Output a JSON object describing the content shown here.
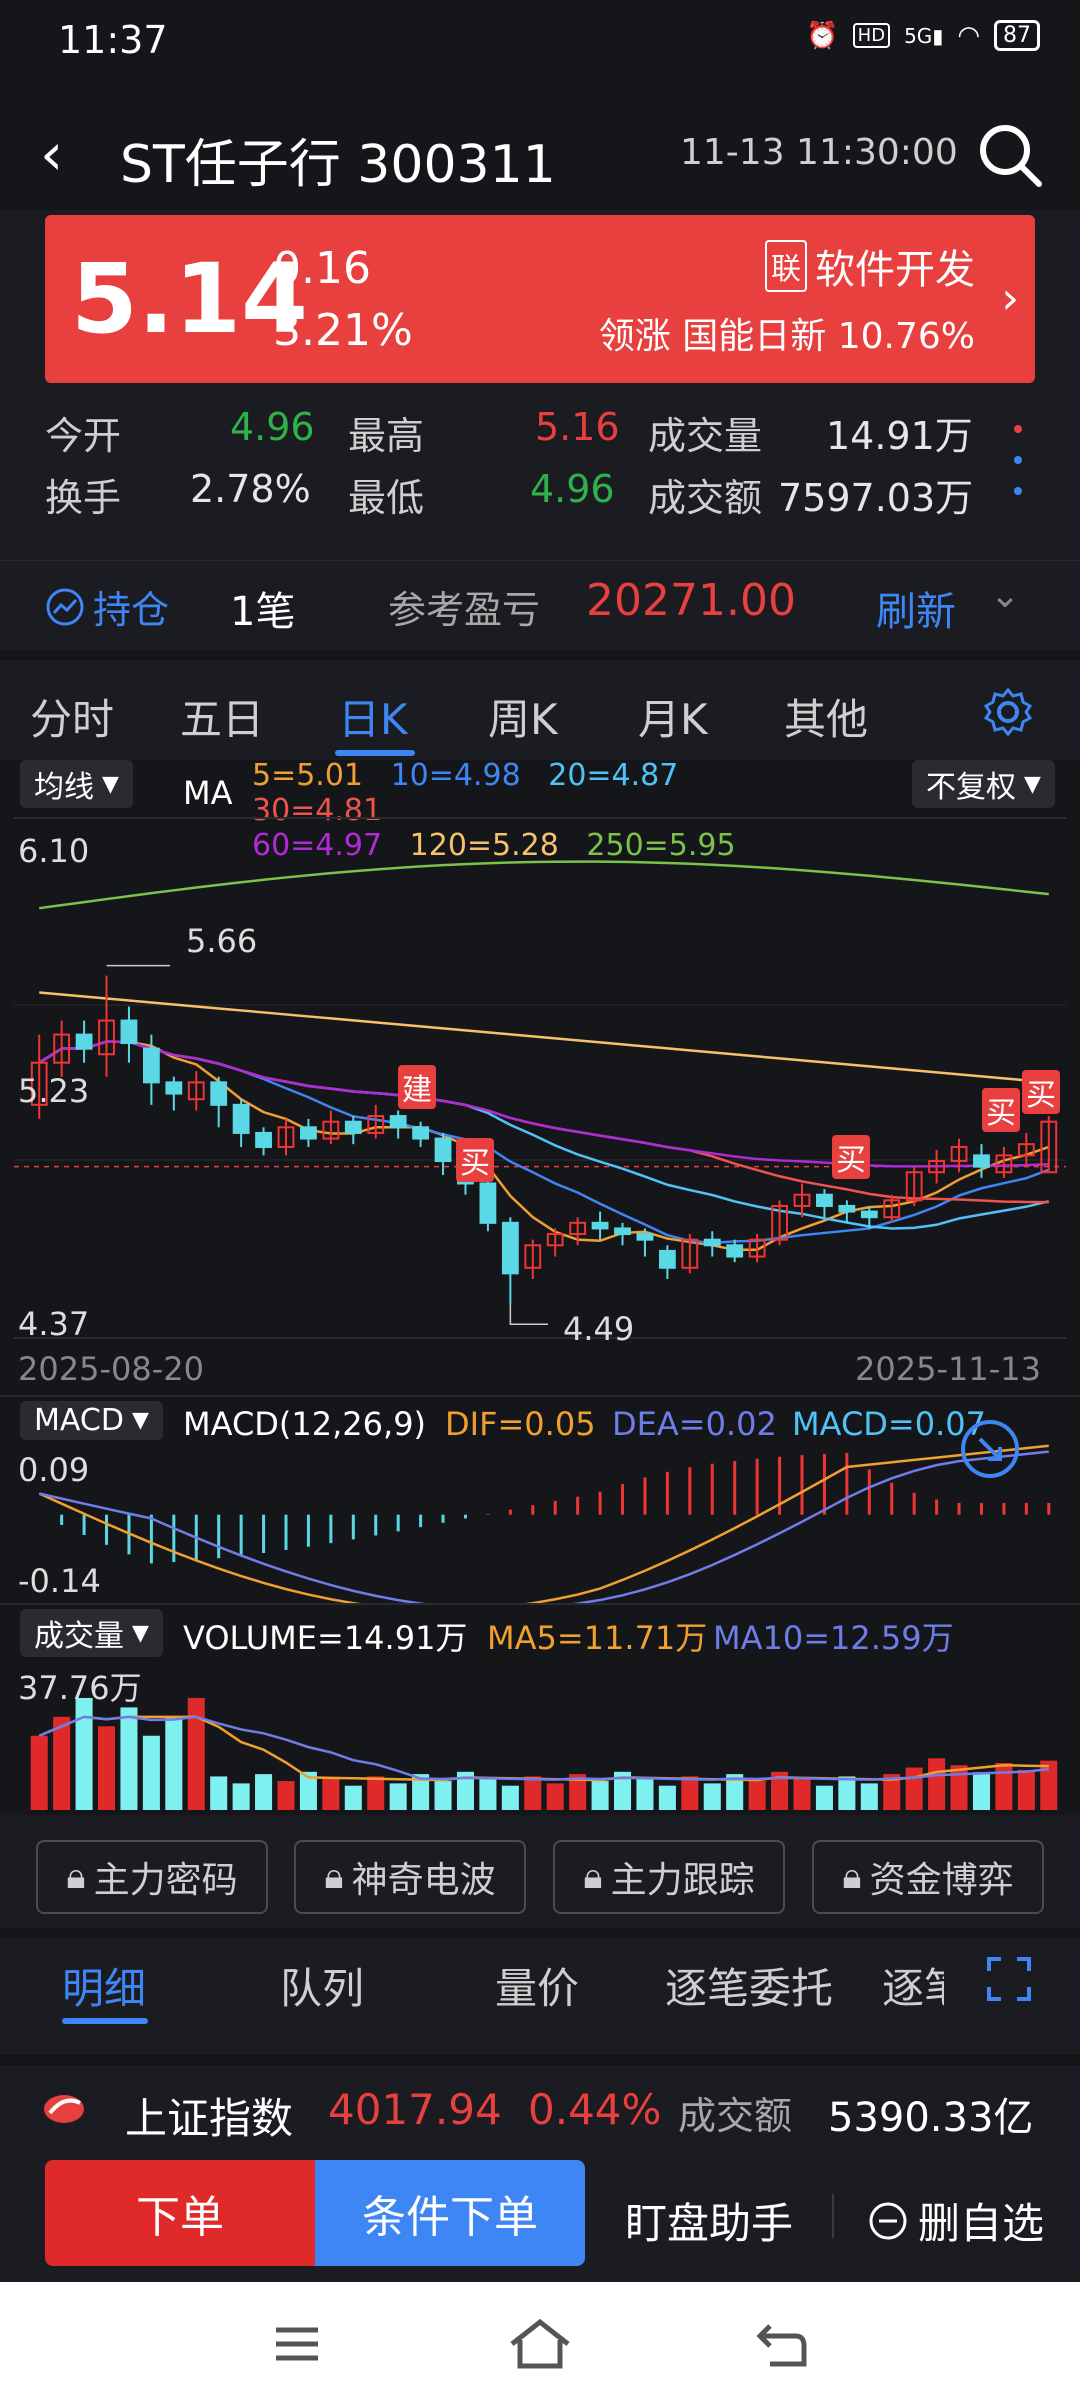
{
  "status_bar": {
    "time": "11:37",
    "icons": [
      "alarm-icon",
      "hd-icon",
      "5g-icon",
      "wifi-icon"
    ],
    "battery": "87"
  },
  "header": {
    "title": "ST任子行 300311",
    "datetime": "11-13 11:30:00"
  },
  "quote": {
    "price": "5.14",
    "change": "0.16",
    "change_pct": "3.21%",
    "sector_badge": "联",
    "sector": "软件开发",
    "lead_label": "领涨",
    "lead_stock": "国能日新",
    "lead_pct": "10.76%"
  },
  "stats": {
    "open_label": "今开",
    "open": "4.96",
    "high_label": "最高",
    "high": "5.16",
    "volume_label": "成交量",
    "volume": "14.91万",
    "turnover_label": "换手",
    "turnover": "2.78%",
    "low_label": "最低",
    "low": "4.96",
    "amount_label": "成交额",
    "amount": "7597.03万"
  },
  "holding": {
    "label": "持仓",
    "count": "1笔",
    "pnl_label": "参考盈亏",
    "pnl": "20271.00",
    "refresh": "刷新"
  },
  "chart_tabs": [
    "分时",
    "五日",
    "日K",
    "周K",
    "月K",
    "其他"
  ],
  "kline": {
    "ma_select": "均线",
    "ma_label": "MA",
    "adjust_select": "不复权",
    "ma": [
      {
        "text": "5=5.01",
        "color": "#f0a030"
      },
      {
        "text": "10=4.98",
        "color": "#3f86f5"
      },
      {
        "text": "20=4.87",
        "color": "#4fc3f7"
      },
      {
        "text": "30=4.81",
        "color": "#ef5350"
      },
      {
        "text": "60=4.97",
        "color": "#b02bd8"
      },
      {
        "text": "120=5.28",
        "color": "#f5c26b"
      },
      {
        "text": "250=5.95",
        "color": "#7cc24a"
      }
    ],
    "y_top": "6.10",
    "y_mid": "5.23",
    "y_bottom": "4.37",
    "max_label": "5.66",
    "min_label": "4.49",
    "date_start": "2025-08-20",
    "date_end": "2025-11-13",
    "marks": [
      "建",
      "买",
      "买",
      "买",
      "买"
    ]
  },
  "macd": {
    "select": "MACD",
    "params": "MACD(12,26,9)",
    "dif": "DIF=0.05",
    "dea": "DEA=0.02",
    "macd": "MACD=0.07",
    "y_top": "0.09",
    "y_bottom": "-0.14"
  },
  "volume": {
    "select": "成交量",
    "volume": "VOLUME=14.91万",
    "ma5": "MA5=11.71万",
    "ma10": "MA10=12.59万",
    "y_top": "37.76万"
  },
  "tools": [
    "主力密码",
    "神奇电波",
    "主力跟踪",
    "资金博弈"
  ],
  "detail_tabs": [
    "明细",
    "队列",
    "量价",
    "逐笔委托",
    "逐笔"
  ],
  "index_bar": {
    "name": "上证指数",
    "value": "4017.94",
    "pct": "0.44%",
    "amount_label": "成交额",
    "amount": "5390.33亿"
  },
  "actions": {
    "order": "下单",
    "cond_order": "条件下单",
    "watch": "盯盘助手",
    "remove": "删自选"
  },
  "chart_data": {
    "type": "candlestick",
    "title": "",
    "x_range": [
      "2025-08-20",
      "2025-11-13"
    ],
    "ylim": [
      4.37,
      6.1
    ],
    "highlighted_high": 5.66,
    "highlighted_low": 4.49,
    "candles": [
      [
        5.2,
        5.35,
        5.45,
        5.15
      ],
      [
        5.35,
        5.45,
        5.5,
        5.3
      ],
      [
        5.45,
        5.4,
        5.5,
        5.35
      ],
      [
        5.38,
        5.5,
        5.66,
        5.3
      ],
      [
        5.5,
        5.42,
        5.55,
        5.35
      ],
      [
        5.4,
        5.28,
        5.45,
        5.2
      ],
      [
        5.28,
        5.24,
        5.3,
        5.18
      ],
      [
        5.22,
        5.28,
        5.32,
        5.18
      ],
      [
        5.28,
        5.2,
        5.3,
        5.12
      ],
      [
        5.2,
        5.1,
        5.22,
        5.05
      ],
      [
        5.1,
        5.05,
        5.12,
        5.02
      ],
      [
        5.05,
        5.12,
        5.15,
        5.02
      ],
      [
        5.12,
        5.08,
        5.15,
        5.05
      ],
      [
        5.08,
        5.14,
        5.18,
        5.06
      ],
      [
        5.14,
        5.1,
        5.16,
        5.06
      ],
      [
        5.1,
        5.16,
        5.2,
        5.08
      ],
      [
        5.16,
        5.12,
        5.18,
        5.08
      ],
      [
        5.12,
        5.08,
        5.14,
        5.05
      ],
      [
        5.08,
        5.0,
        5.1,
        4.95
      ],
      [
        5.0,
        4.92,
        5.02,
        4.88
      ],
      [
        4.92,
        4.78,
        4.95,
        4.75
      ],
      [
        4.78,
        4.6,
        4.8,
        4.49
      ],
      [
        4.62,
        4.7,
        4.72,
        4.58
      ],
      [
        4.7,
        4.74,
        4.76,
        4.66
      ],
      [
        4.74,
        4.78,
        4.8,
        4.7
      ],
      [
        4.78,
        4.76,
        4.82,
        4.72
      ],
      [
        4.76,
        4.74,
        4.78,
        4.7
      ],
      [
        4.74,
        4.72,
        4.76,
        4.66
      ],
      [
        4.68,
        4.62,
        4.7,
        4.58
      ],
      [
        4.62,
        4.72,
        4.74,
        4.6
      ],
      [
        4.72,
        4.7,
        4.75,
        4.66
      ],
      [
        4.7,
        4.66,
        4.72,
        4.64
      ],
      [
        4.66,
        4.72,
        4.74,
        4.64
      ],
      [
        4.72,
        4.84,
        4.86,
        4.7
      ],
      [
        4.84,
        4.88,
        4.92,
        4.8
      ],
      [
        4.88,
        4.84,
        4.9,
        4.8
      ],
      [
        4.84,
        4.82,
        4.86,
        4.78
      ],
      [
        4.82,
        4.8,
        4.84,
        4.76
      ],
      [
        4.8,
        4.86,
        4.88,
        4.78
      ],
      [
        4.86,
        4.96,
        4.98,
        4.84
      ],
      [
        4.96,
        5.0,
        5.04,
        4.92
      ],
      [
        5.0,
        5.05,
        5.08,
        4.96
      ],
      [
        5.02,
        4.98,
        5.06,
        4.94
      ],
      [
        4.96,
        5.02,
        5.05,
        4.94
      ],
      [
        5.02,
        5.06,
        5.1,
        4.98
      ],
      [
        4.96,
        5.14,
        5.16,
        4.96
      ]
    ],
    "macd_range": [
      -0.14,
      0.09
    ],
    "volume_max": "37.76万"
  }
}
